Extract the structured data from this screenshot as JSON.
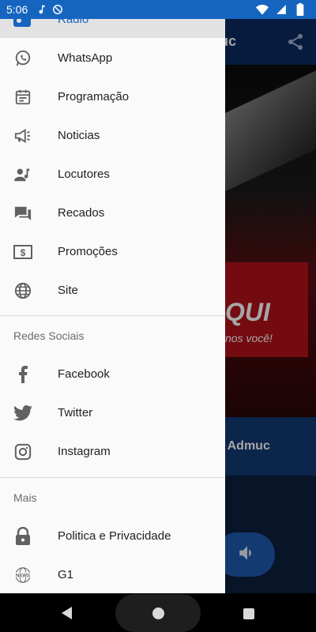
{
  "status_bar": {
    "time": "5:06",
    "icons": [
      "music-note-icon",
      "at-sign-icon",
      "wifi-icon",
      "signal-icon",
      "battery-icon"
    ]
  },
  "background_app": {
    "toolbar_title_partial": "uc",
    "banner_slogan_line1": "QUI",
    "banner_slogan_line2": "nos você!",
    "namebar_text_partial": "o Admuc"
  },
  "drawer": {
    "partial_item": {
      "label": "Radio",
      "icon": "radio-icon"
    },
    "main_items": [
      {
        "label": "WhatsApp",
        "icon": "whatsapp-icon"
      },
      {
        "label": "Programação",
        "icon": "calendar-icon"
      },
      {
        "label": "Noticias",
        "icon": "megaphone-icon"
      },
      {
        "label": "Locutores",
        "icon": "person-music-icon"
      },
      {
        "label": "Recados",
        "icon": "chat-icon"
      },
      {
        "label": "Promoções",
        "icon": "dollar-bill-icon"
      },
      {
        "label": "Site",
        "icon": "globe-icon"
      }
    ],
    "social_header": "Redes Sociais",
    "social_items": [
      {
        "label": "Facebook",
        "icon": "facebook-icon"
      },
      {
        "label": "Twitter",
        "icon": "twitter-icon"
      },
      {
        "label": "Instagram",
        "icon": "instagram-icon"
      }
    ],
    "more_header": "Mais",
    "more_items": [
      {
        "label": "Politica e Privacidade",
        "icon": "lock-icon"
      },
      {
        "label": "G1",
        "icon": "news-globe-icon"
      }
    ]
  },
  "colors": {
    "accent": "#1565c0",
    "icon_gray": "#616161",
    "drawer_bg": "#fafafa"
  }
}
